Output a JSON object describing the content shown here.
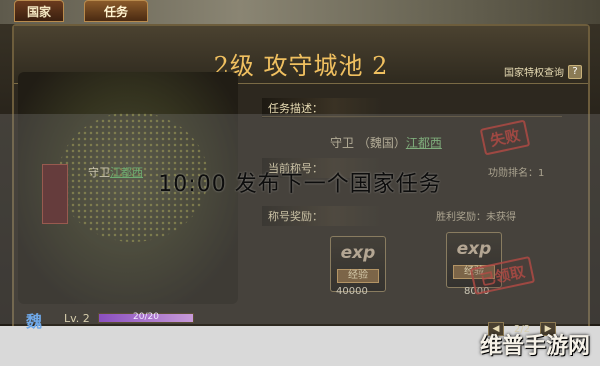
{
  "tabs": [
    {
      "label": "国家",
      "active": false
    },
    {
      "label": "任务",
      "active": true
    }
  ],
  "title": "2级 攻守城池 2",
  "privilege_label": "国家特权查询",
  "help_label": "?",
  "map": {
    "guard_prefix": "守卫",
    "guard_city": "江都西"
  },
  "player": {
    "kingdom": "魏",
    "level": "Lv. 2",
    "xp_text": "20/20",
    "xp_fraction": 1.0
  },
  "sections": {
    "task_desc": "任务描述：",
    "current_title": "当前称号：",
    "title_reward": "称号奖励："
  },
  "task": {
    "prefix": "守卫 （魏国）",
    "city": "江都西"
  },
  "rank_label": "功勋排名：1",
  "reward_status": "胜利奖励：未获得",
  "rewards": [
    {
      "icon": "exp",
      "label": "经验",
      "amount": "40000"
    },
    {
      "icon": "exp",
      "label": "经验",
      "amount": "8000"
    }
  ],
  "stamps": {
    "fail": "失败",
    "claimed": "已领取"
  },
  "announcement": "10:00 发布下一个国家任务",
  "pager": {
    "text": "2/2",
    "prev": "◀",
    "next": "▶"
  },
  "watermark": "维普手游网",
  "colors": {
    "accent_gold": "#f0c060",
    "stamp_red": "#c2322a",
    "kingdom_blue": "#6fa8e8"
  }
}
